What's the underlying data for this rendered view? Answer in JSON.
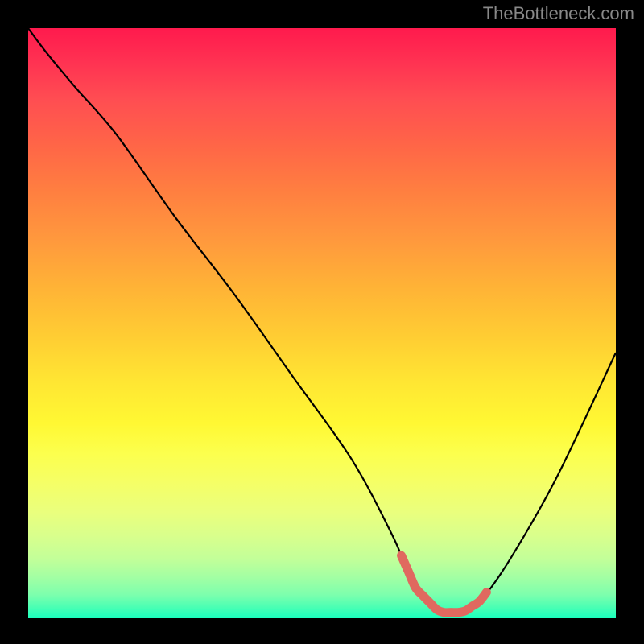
{
  "attribution": "TheBottleneck.com",
  "chart_data": {
    "type": "line",
    "title": "",
    "xlabel": "",
    "ylabel": "",
    "xlim": [
      0,
      100
    ],
    "ylim": [
      0,
      100
    ],
    "series": [
      {
        "name": "bottleneck-curve",
        "x": [
          0,
          3,
          8,
          15,
          25,
          35,
          45,
          55,
          62,
          66,
          70,
          74,
          77,
          82,
          90,
          100
        ],
        "y": [
          100,
          96,
          90,
          82,
          68,
          55,
          41,
          27,
          14,
          5,
          1,
          1,
          3,
          10,
          24,
          45
        ]
      }
    ],
    "highlight_segment": {
      "x_start": 63.5,
      "x_end": 78,
      "note": "optimal range marker"
    },
    "gradient_meaning": "top=red=high bottleneck, bottom=green=low bottleneck"
  },
  "colors": {
    "curve": "#000000",
    "highlight": "#e0695f",
    "background": "#000000"
  }
}
